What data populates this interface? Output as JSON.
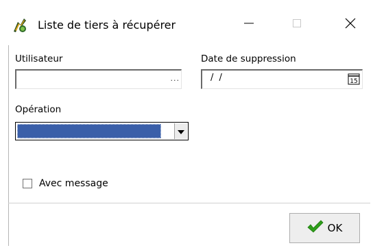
{
  "window": {
    "title": "Liste de tiers à récupérer",
    "icon": "app-logo-icon",
    "controls": [
      "minimize-icon",
      "maximize-icon",
      "close-icon"
    ]
  },
  "form": {
    "utilisateur": {
      "label": "Utilisateur",
      "value": "",
      "browse_label": "..."
    },
    "date_suppression": {
      "label": "Date de suppression",
      "value": "/ /",
      "calendar_icon": "calendar-icon",
      "calendar_day": "15"
    },
    "operation": {
      "label": "Opération",
      "selected": ""
    },
    "avec_message": {
      "label": "Avec message",
      "checked": false
    }
  },
  "footer": {
    "ok_label": "OK",
    "ok_icon": "checkmark-icon"
  },
  "colors": {
    "selection": "#3a5fa9",
    "checkmark": "#2e9e1a",
    "background": "#ffffff"
  }
}
